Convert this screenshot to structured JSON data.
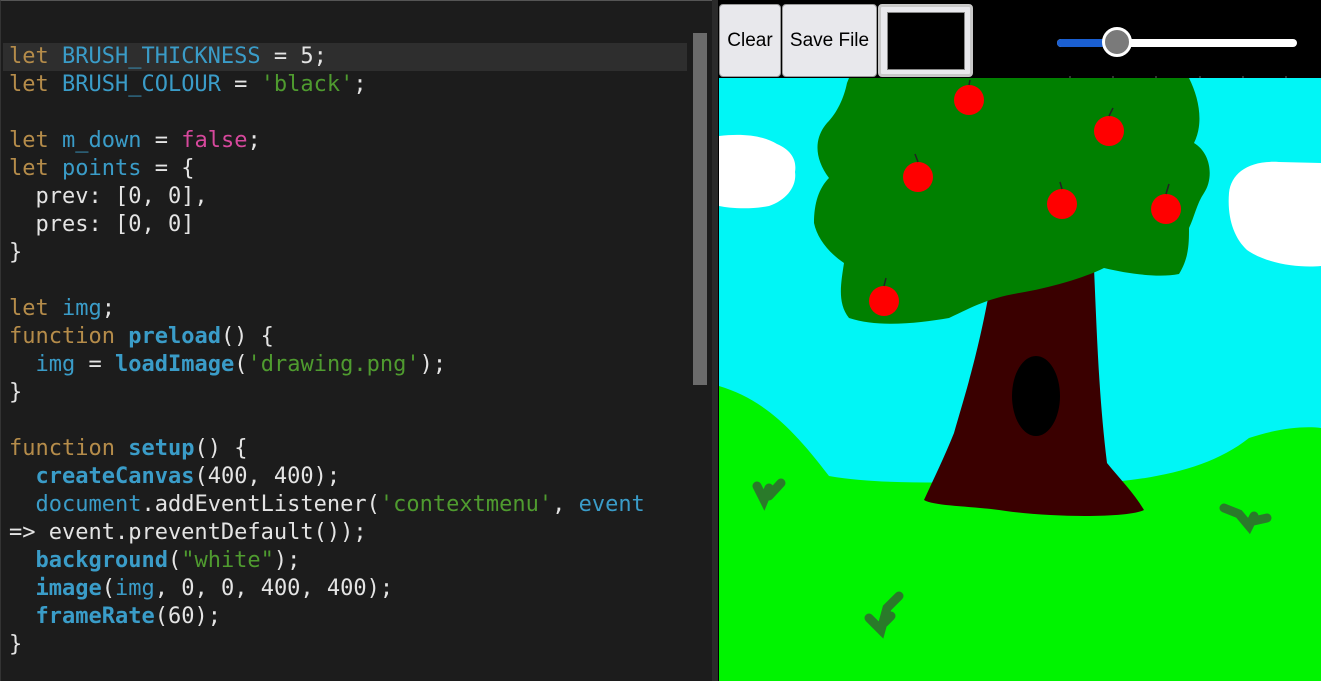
{
  "editor": {
    "lines": [
      [
        [
          "kw",
          "let "
        ],
        [
          "var",
          "BRUSH_THICKNESS"
        ],
        [
          "plain",
          " = 5;"
        ]
      ],
      [
        [
          "kw",
          "let "
        ],
        [
          "var",
          "BRUSH_COLOUR"
        ],
        [
          "plain",
          " = "
        ],
        [
          "str",
          "'black'"
        ],
        [
          "plain",
          ";"
        ]
      ],
      [],
      [
        [
          "kw",
          "let "
        ],
        [
          "var",
          "m_down"
        ],
        [
          "plain",
          " = "
        ],
        [
          "bool",
          "false"
        ],
        [
          "plain",
          ";"
        ]
      ],
      [
        [
          "kw",
          "let "
        ],
        [
          "var",
          "points"
        ],
        [
          "plain",
          " = {"
        ]
      ],
      [
        [
          "plain",
          "  prev: [0, 0],"
        ]
      ],
      [
        [
          "plain",
          "  pres: [0, 0]"
        ]
      ],
      [
        [
          "plain",
          "}"
        ]
      ],
      [],
      [
        [
          "kw",
          "let "
        ],
        [
          "var",
          "img"
        ],
        [
          "plain",
          ";"
        ]
      ],
      [
        [
          "kw",
          "function "
        ],
        [
          "fn",
          "preload"
        ],
        [
          "plain",
          "() {"
        ]
      ],
      [
        [
          "plain",
          "  "
        ],
        [
          "var",
          "img"
        ],
        [
          "plain",
          " = "
        ],
        [
          "fn",
          "loadImage"
        ],
        [
          "plain",
          "("
        ],
        [
          "str",
          "'drawing.png'"
        ],
        [
          "plain",
          ");"
        ]
      ],
      [
        [
          "plain",
          "}"
        ]
      ],
      [],
      [
        [
          "kw",
          "function "
        ],
        [
          "fn",
          "setup"
        ],
        [
          "plain",
          "() {"
        ]
      ],
      [
        [
          "plain",
          "  "
        ],
        [
          "fn",
          "createCanvas"
        ],
        [
          "plain",
          "(400, 400);"
        ]
      ],
      [
        [
          "plain",
          "  "
        ],
        [
          "var",
          "document"
        ],
        [
          "plain",
          ".addEventListener("
        ],
        [
          "str",
          "'contextmenu'"
        ],
        [
          "plain",
          ", "
        ],
        [
          "var",
          "event"
        ]
      ],
      [
        [
          "plain",
          "=> event.preventDefault());"
        ]
      ],
      [
        [
          "plain",
          "  "
        ],
        [
          "fn",
          "background"
        ],
        [
          "plain",
          "("
        ],
        [
          "str",
          "\"white\""
        ],
        [
          "plain",
          ");"
        ]
      ],
      [
        [
          "plain",
          "  "
        ],
        [
          "fn",
          "image"
        ],
        [
          "plain",
          "("
        ],
        [
          "var",
          "img"
        ],
        [
          "plain",
          ", 0, 0, 400, 400);"
        ]
      ],
      [
        [
          "plain",
          "  "
        ],
        [
          "fn",
          "frameRate"
        ],
        [
          "plain",
          "(60);"
        ]
      ],
      [
        [
          "plain",
          "}"
        ]
      ]
    ]
  },
  "toolbar": {
    "clear_label": "Clear",
    "save_label": "Save File",
    "brush_colour": "#000000",
    "thickness_fraction": 0.25
  },
  "colors": {
    "sky": "#00f6f6",
    "grass": "#00f400",
    "foliage": "#008000",
    "trunk": "#3a0000",
    "apple": "#ff0000",
    "cloud": "#ffffff",
    "hole": "#000000",
    "tuft": "#2a7a2a"
  }
}
